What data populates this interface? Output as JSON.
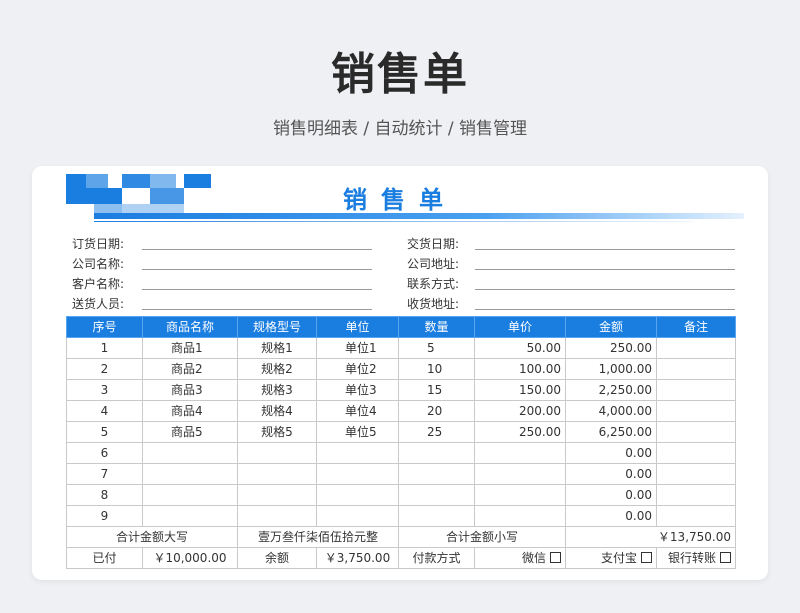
{
  "page": {
    "title": "销售单",
    "subtitle": "销售明细表 / 自动统计 / 销售管理"
  },
  "form": {
    "title": "销售单",
    "fields_left": [
      {
        "label": "订货日期:",
        "value": ""
      },
      {
        "label": "公司名称:",
        "value": ""
      },
      {
        "label": "客户名称:",
        "value": ""
      },
      {
        "label": "送货人员:",
        "value": ""
      }
    ],
    "fields_right": [
      {
        "label": "交货日期:",
        "value": ""
      },
      {
        "label": "公司地址:",
        "value": ""
      },
      {
        "label": "联系方式:",
        "value": ""
      },
      {
        "label": "收货地址:",
        "value": ""
      }
    ]
  },
  "table": {
    "headers": [
      "序号",
      "商品名称",
      "规格型号",
      "单位",
      "数量",
      "单价",
      "金额",
      "备注"
    ],
    "rows": [
      [
        "1",
        "商品1",
        "规格1",
        "单位1",
        "5",
        "50.00",
        "250.00",
        ""
      ],
      [
        "2",
        "商品2",
        "规格2",
        "单位2",
        "10",
        "100.00",
        "1,000.00",
        ""
      ],
      [
        "3",
        "商品3",
        "规格3",
        "单位3",
        "15",
        "150.00",
        "2,250.00",
        ""
      ],
      [
        "4",
        "商品4",
        "规格4",
        "单位4",
        "20",
        "200.00",
        "4,000.00",
        ""
      ],
      [
        "5",
        "商品5",
        "规格5",
        "单位5",
        "25",
        "250.00",
        "6,250.00",
        ""
      ],
      [
        "6",
        "",
        "",
        "",
        "",
        "",
        "0.00",
        ""
      ],
      [
        "7",
        "",
        "",
        "",
        "",
        "",
        "0.00",
        ""
      ],
      [
        "8",
        "",
        "",
        "",
        "",
        "",
        "0.00",
        ""
      ],
      [
        "9",
        "",
        "",
        "",
        "",
        "",
        "0.00",
        ""
      ]
    ],
    "total_upper_label": "合计金额大写",
    "total_upper_value": "壹万叁仟柒佰伍拾元整",
    "total_lower_label": "合计金额小写",
    "total_lower_value": "￥13,750.00",
    "paid_label": "已付",
    "paid_value": "￥10,000.00",
    "balance_label": "余额",
    "balance_value": "￥3,750.00",
    "payment_method_label": "付款方式",
    "payment_options": [
      "微信",
      "支付宝",
      "银行转账"
    ]
  },
  "colors": {
    "accent": "#1a7de0",
    "background": "#eef0f3"
  }
}
